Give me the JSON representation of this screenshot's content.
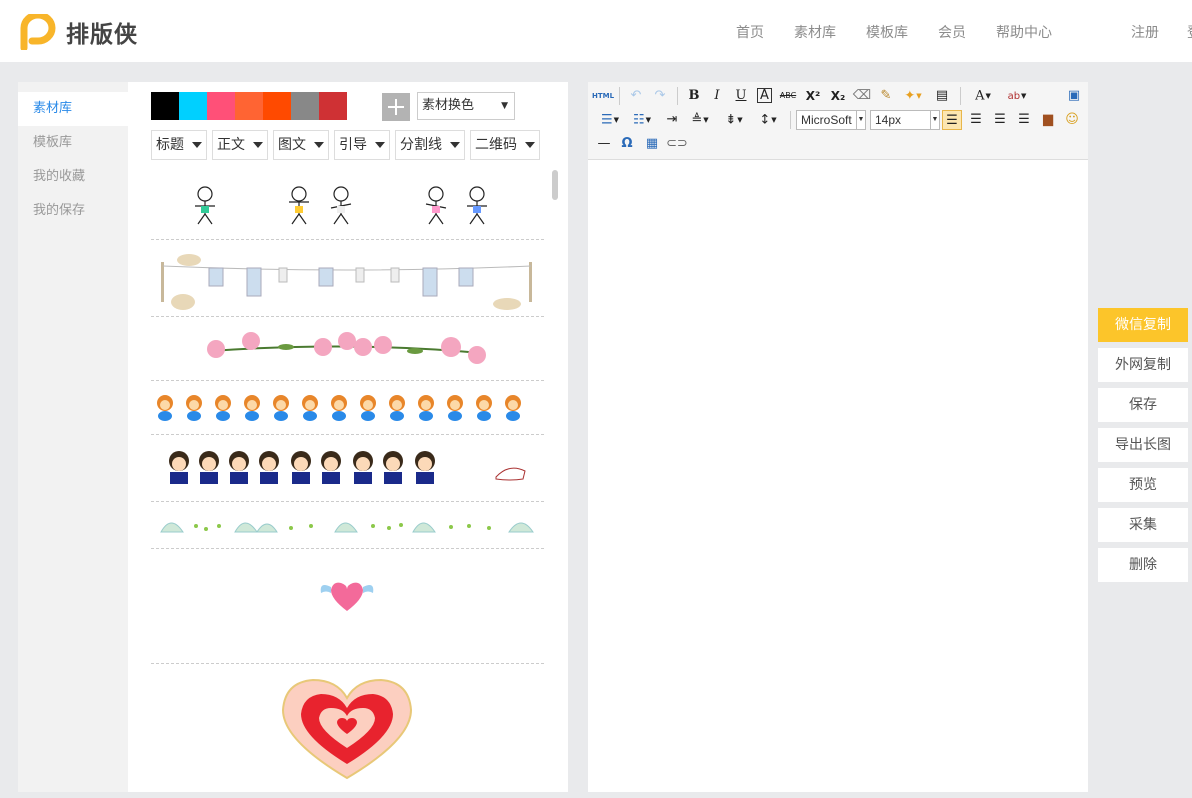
{
  "header": {
    "brand": "排版侠",
    "nav": [
      "首页",
      "素材库",
      "模板库",
      "会员",
      "帮助中心"
    ],
    "register": "注册",
    "login_partial": "登"
  },
  "sidebar": {
    "items": [
      "素材库",
      "模板库",
      "我的收藏",
      "我的保存"
    ],
    "active_index": 0
  },
  "materials": {
    "colors": [
      "#000000",
      "#00d0ff",
      "#ff5078",
      "#ff6433",
      "#ff4a00",
      "#888888",
      "#cf3134"
    ],
    "color_switch": "素材换色",
    "categories": [
      "标题",
      "正文",
      "图文",
      "引导",
      "分割线",
      "二维码"
    ],
    "items": [
      "dancing-stick-figures",
      "clothesline-with-cats",
      "pink-flower-branch",
      "monkey-row",
      "cartoon-boys-row",
      "seashells-border",
      "winged-heart",
      "big-layered-heart"
    ]
  },
  "editor": {
    "html_button": "HTML",
    "font_family": "MicroSoft",
    "font_size": "14px",
    "bold": "B",
    "italic": "I",
    "underline": "U",
    "font_color": "A",
    "strike": "ABC",
    "superscript": "X²",
    "subscript": "X₂",
    "omega": "Ω"
  },
  "actions": [
    "微信复制",
    "外网复制",
    "保存",
    "导出长图",
    "预览",
    "采集",
    "删除"
  ]
}
